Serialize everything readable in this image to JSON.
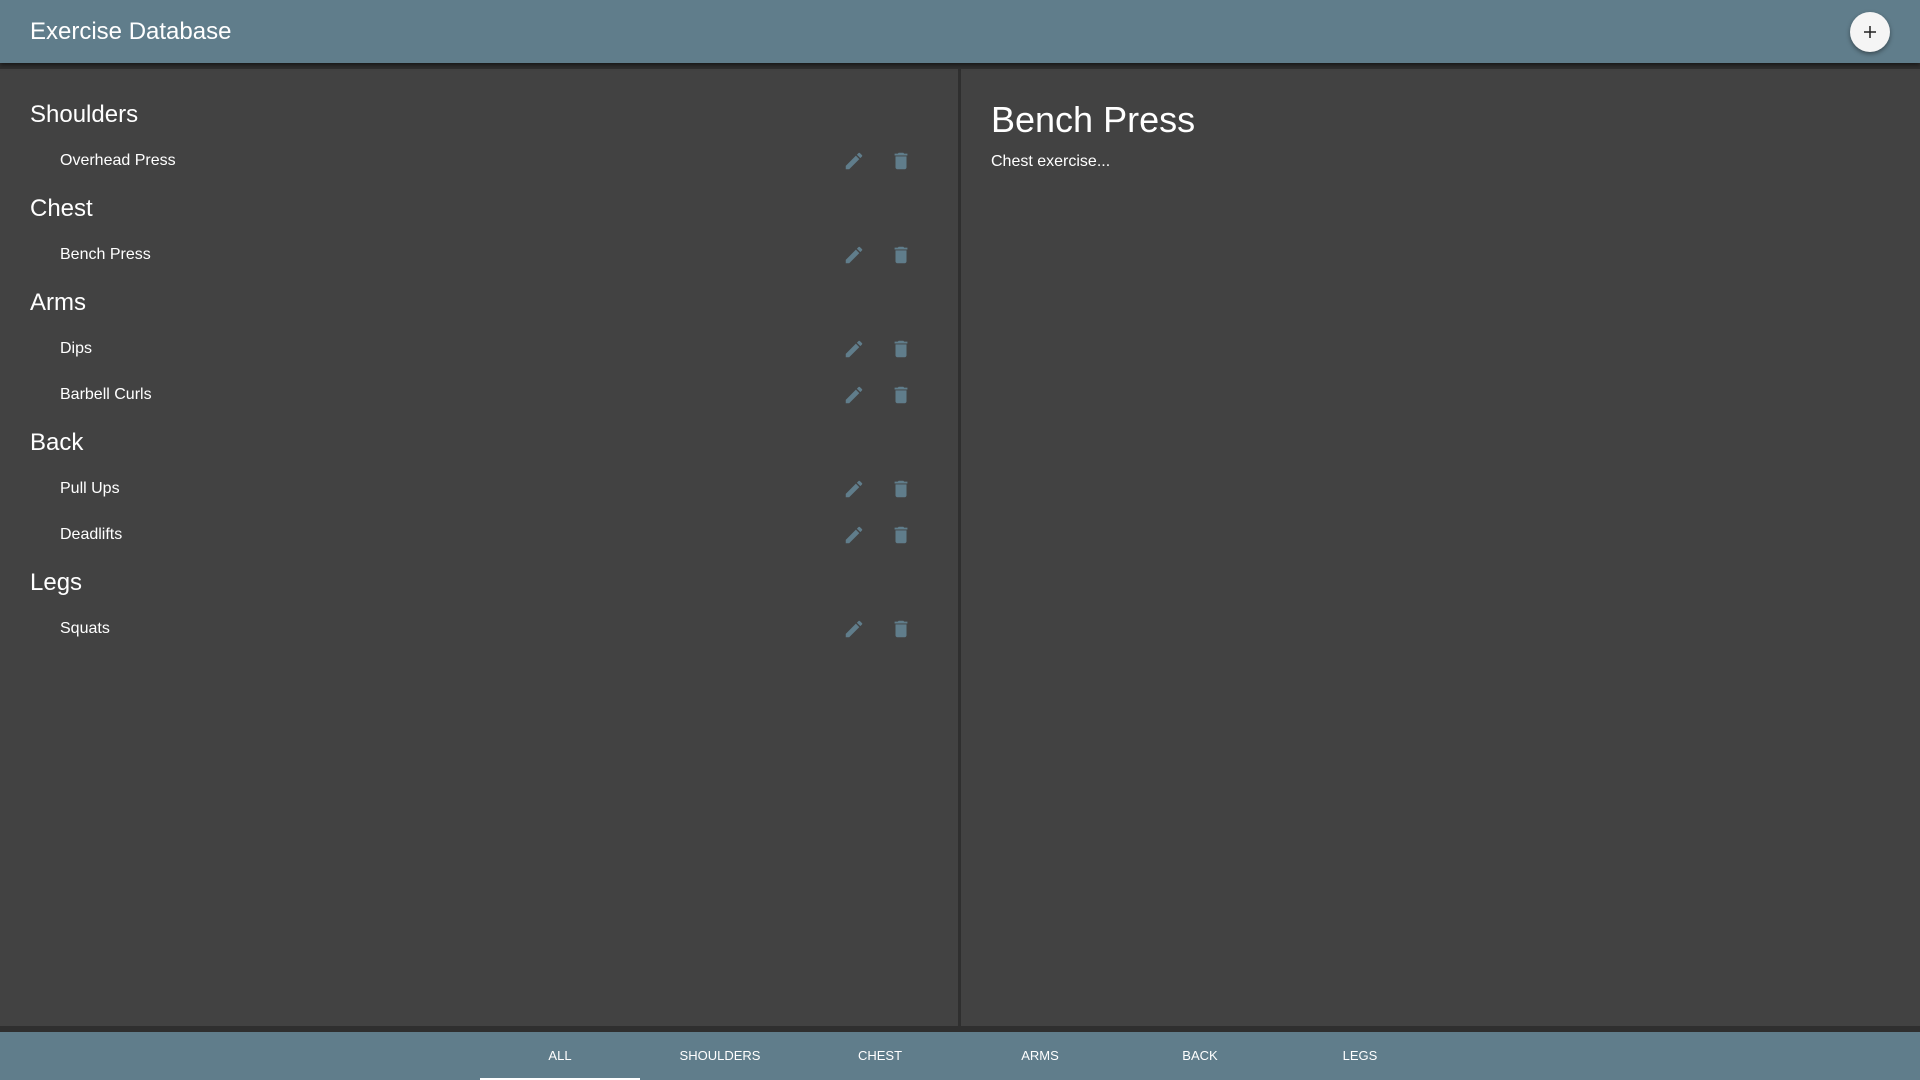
{
  "appbar": {
    "title": "Exercise Database",
    "add_icon": "plus-icon"
  },
  "groups": [
    {
      "name": "Shoulders",
      "exercises": [
        "Overhead Press"
      ]
    },
    {
      "name": "Chest",
      "exercises": [
        "Bench Press"
      ]
    },
    {
      "name": "Arms",
      "exercises": [
        "Dips",
        "Barbell Curls"
      ]
    },
    {
      "name": "Back",
      "exercises": [
        "Pull Ups",
        "Deadlifts"
      ]
    },
    {
      "name": "Legs",
      "exercises": [
        "Squats"
      ]
    }
  ],
  "detail": {
    "title": "Bench Press",
    "description": "Chest exercise..."
  },
  "tabs": [
    {
      "label": "All",
      "active": true
    },
    {
      "label": "Shoulders",
      "active": false
    },
    {
      "label": "Chest",
      "active": false
    },
    {
      "label": "Arms",
      "active": false
    },
    {
      "label": "Back",
      "active": false
    },
    {
      "label": "Legs",
      "active": false
    }
  ],
  "colors": {
    "primary": "#607d8b",
    "panel": "#424242",
    "background": "#2f2f2f"
  }
}
